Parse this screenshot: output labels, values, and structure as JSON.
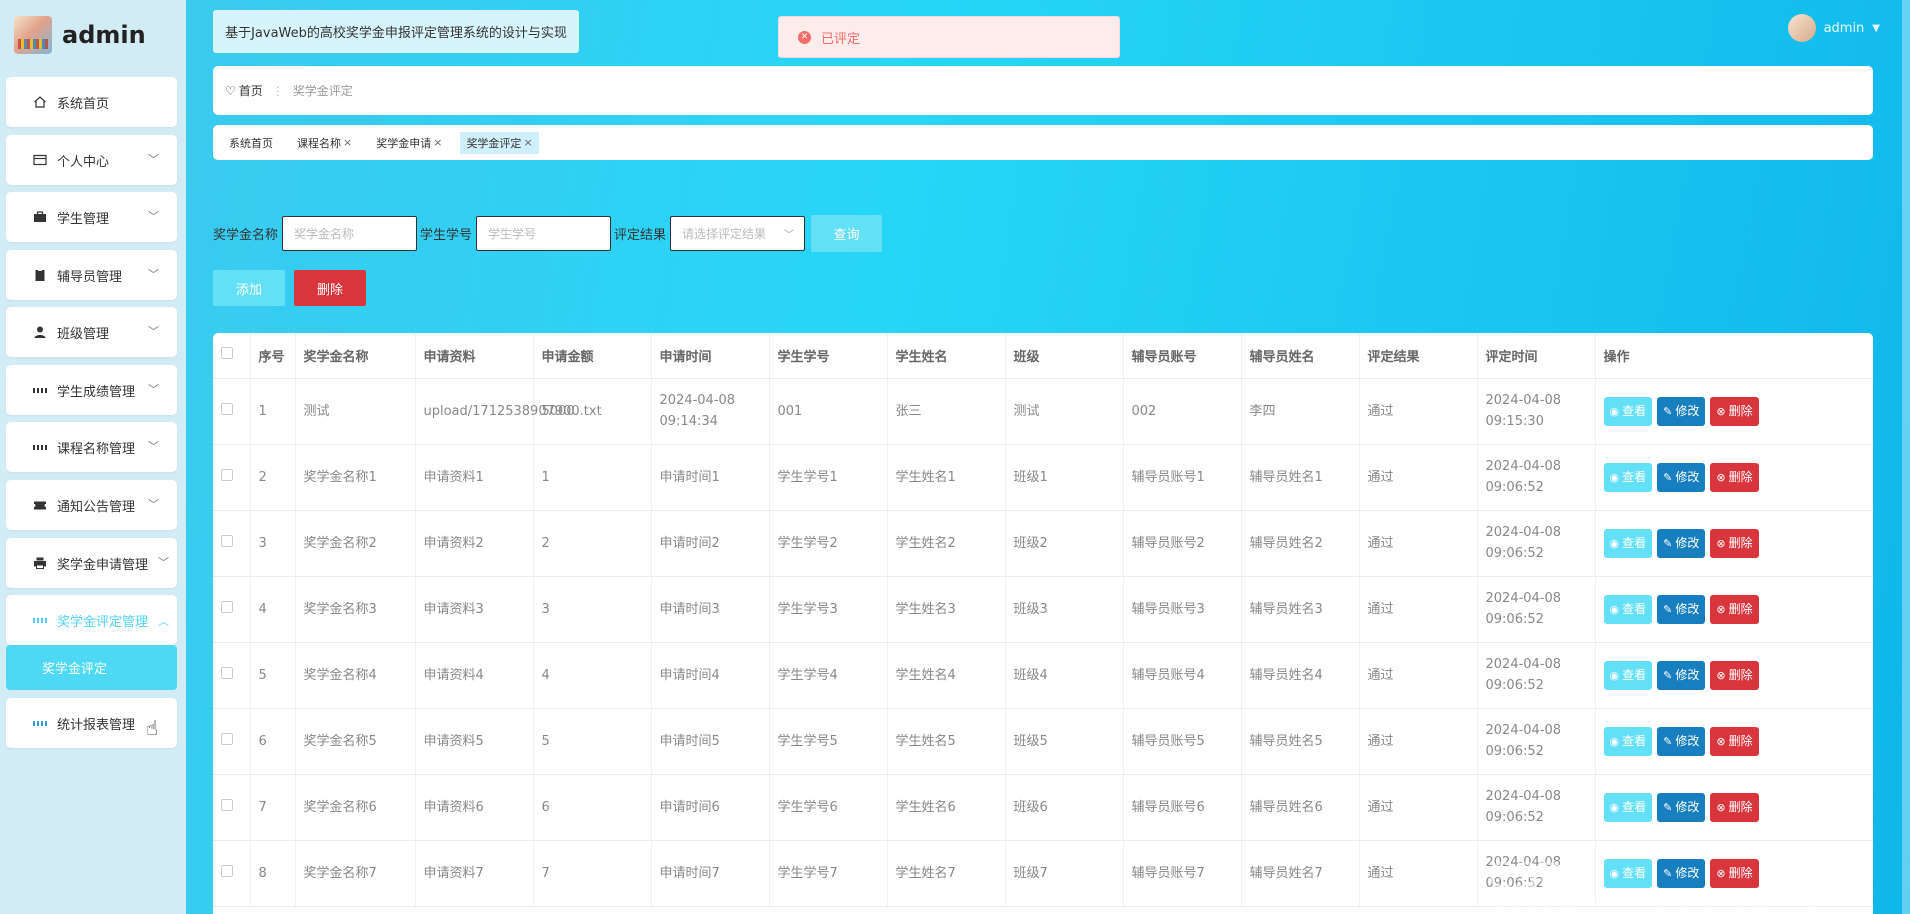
{
  "brand": {
    "name": "admin"
  },
  "sidebar": {
    "items": [
      {
        "label": "系统首页",
        "icon": "home-icon"
      },
      {
        "label": "个人中心",
        "icon": "card-icon"
      },
      {
        "label": "学生管理",
        "icon": "briefcase-icon"
      },
      {
        "label": "辅导员管理",
        "icon": "clipboard-icon"
      },
      {
        "label": "班级管理",
        "icon": "user-icon"
      },
      {
        "label": "学生成绩管理",
        "icon": "grid-icon"
      },
      {
        "label": "课程名称管理",
        "icon": "grid-icon"
      },
      {
        "label": "通知公告管理",
        "icon": "ticket-icon"
      },
      {
        "label": "奖学金申请管理",
        "icon": "printer-icon"
      },
      {
        "label": "奖学金评定管理",
        "icon": "grid-icon"
      },
      {
        "label": "统计报表管理",
        "icon": "grid-icon"
      }
    ],
    "submenu": {
      "label": "奖学金评定"
    }
  },
  "header": {
    "title": "基于JavaWeb的高校奖学金申报评定管理系统的设计与实现",
    "toast": "已评定",
    "user": "admin"
  },
  "breadcrumb": {
    "home": "首页",
    "current": "奖学金评定"
  },
  "tags": [
    {
      "label": "系统首页",
      "closable": false
    },
    {
      "label": "课程名称",
      "closable": true
    },
    {
      "label": "奖学金申请",
      "closable": true
    },
    {
      "label": "奖学金评定",
      "closable": true
    }
  ],
  "search": {
    "name_label": "奖学金名称",
    "name_placeholder": "奖学金名称",
    "sid_label": "学生学号",
    "sid_placeholder": "学生学号",
    "result_label": "评定结果",
    "result_placeholder": "请选择评定结果",
    "query": "查询"
  },
  "actions": {
    "add": "添加",
    "delete": "删除"
  },
  "table": {
    "headers": [
      "序号",
      "奖学金名称",
      "申请资料",
      "申请金额",
      "申请时间",
      "学生学号",
      "学生姓名",
      "班级",
      "辅导员账号",
      "辅导员姓名",
      "评定结果",
      "评定时间",
      "操作"
    ],
    "ops": {
      "view": "查看",
      "edit": "修改",
      "delete": "删除"
    },
    "rows": [
      [
        "1",
        "测试",
        "upload/1712538907900.txt",
        "5000",
        "2024-04-08 09:14:34",
        "001",
        "张三",
        "测试",
        "002",
        "李四",
        "通过",
        "2024-04-08 09:15:30"
      ],
      [
        "2",
        "奖学金名称1",
        "申请资料1",
        "1",
        "申请时间1",
        "学生学号1",
        "学生姓名1",
        "班级1",
        "辅导员账号1",
        "辅导员姓名1",
        "通过",
        "2024-04-08 09:06:52"
      ],
      [
        "3",
        "奖学金名称2",
        "申请资料2",
        "2",
        "申请时间2",
        "学生学号2",
        "学生姓名2",
        "班级2",
        "辅导员账号2",
        "辅导员姓名2",
        "通过",
        "2024-04-08 09:06:52"
      ],
      [
        "4",
        "奖学金名称3",
        "申请资料3",
        "3",
        "申请时间3",
        "学生学号3",
        "学生姓名3",
        "班级3",
        "辅导员账号3",
        "辅导员姓名3",
        "通过",
        "2024-04-08 09:06:52"
      ],
      [
        "5",
        "奖学金名称4",
        "申请资料4",
        "4",
        "申请时间4",
        "学生学号4",
        "学生姓名4",
        "班级4",
        "辅导员账号4",
        "辅导员姓名4",
        "通过",
        "2024-04-08 09:06:52"
      ],
      [
        "6",
        "奖学金名称5",
        "申请资料5",
        "5",
        "申请时间5",
        "学生学号5",
        "学生姓名5",
        "班级5",
        "辅导员账号5",
        "辅导员姓名5",
        "通过",
        "2024-04-08 09:06:52"
      ],
      [
        "7",
        "奖学金名称6",
        "申请资料6",
        "6",
        "申请时间6",
        "学生学号6",
        "学生姓名6",
        "班级6",
        "辅导员账号6",
        "辅导员姓名6",
        "通过",
        "2024-04-08 09:06:52"
      ],
      [
        "8",
        "奖学金名称7",
        "申请资料7",
        "7",
        "申请时间7",
        "学生学号7",
        "学生姓名7",
        "班级7",
        "辅导员账号7",
        "辅导员姓名7",
        "通过",
        "2024-04-08 09:06:52"
      ]
    ]
  },
  "watermark": "CSDN @QQ3359892174"
}
